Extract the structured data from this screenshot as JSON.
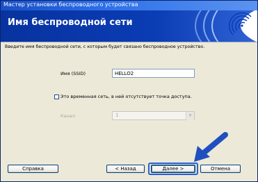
{
  "window": {
    "title": "Мастер установки беспроводного устройства"
  },
  "header": {
    "title": "Имя беспроводной сети"
  },
  "main": {
    "description": "Введите имя беспроводной сети, с которым будет связано беспроводное устройство.",
    "ssid": {
      "label": "Имя (SSID)",
      "value": "HELLO2"
    },
    "adhoc_checkbox": {
      "label": "Это временная сеть, в ней отсутствует точка доступа.",
      "checked": false
    },
    "channel": {
      "label": "Канал",
      "value": "1"
    }
  },
  "footer": {
    "help_label": "Справка",
    "back_label": "< Назад",
    "next_label": "Далее >",
    "cancel_label": "Отмена"
  },
  "colors": {
    "banner": "#0a3cb4",
    "highlight": "#2a5ed4",
    "arrow": "#1f4fbf"
  }
}
